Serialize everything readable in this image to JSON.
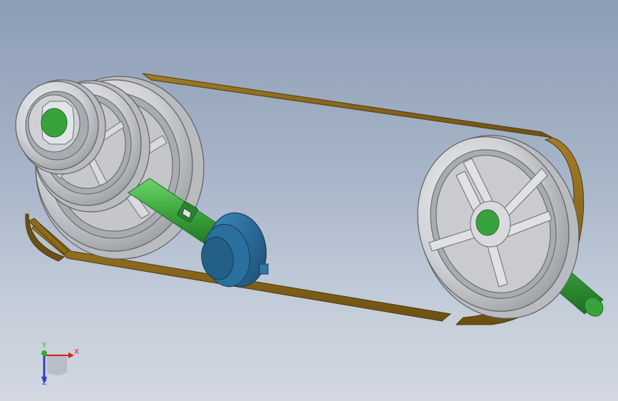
{
  "viewport": {
    "background_top": "#8d9db5",
    "background_bottom": "#d3d8e1"
  },
  "colors": {
    "belt": "#8c6a1c",
    "belt_edge": "#5e4612",
    "pulley": "#d2d3d6",
    "pulley_shade": "#9ea0a5",
    "shaft": "#3aa23c",
    "coupling": "#2a6f9e",
    "axis_x": "#d42020",
    "axis_y": "#2bb32b",
    "axis_z": "#2b3fd0"
  },
  "triad": {
    "x_label": "X",
    "y_label": "Y",
    "z_label": "Z"
  }
}
